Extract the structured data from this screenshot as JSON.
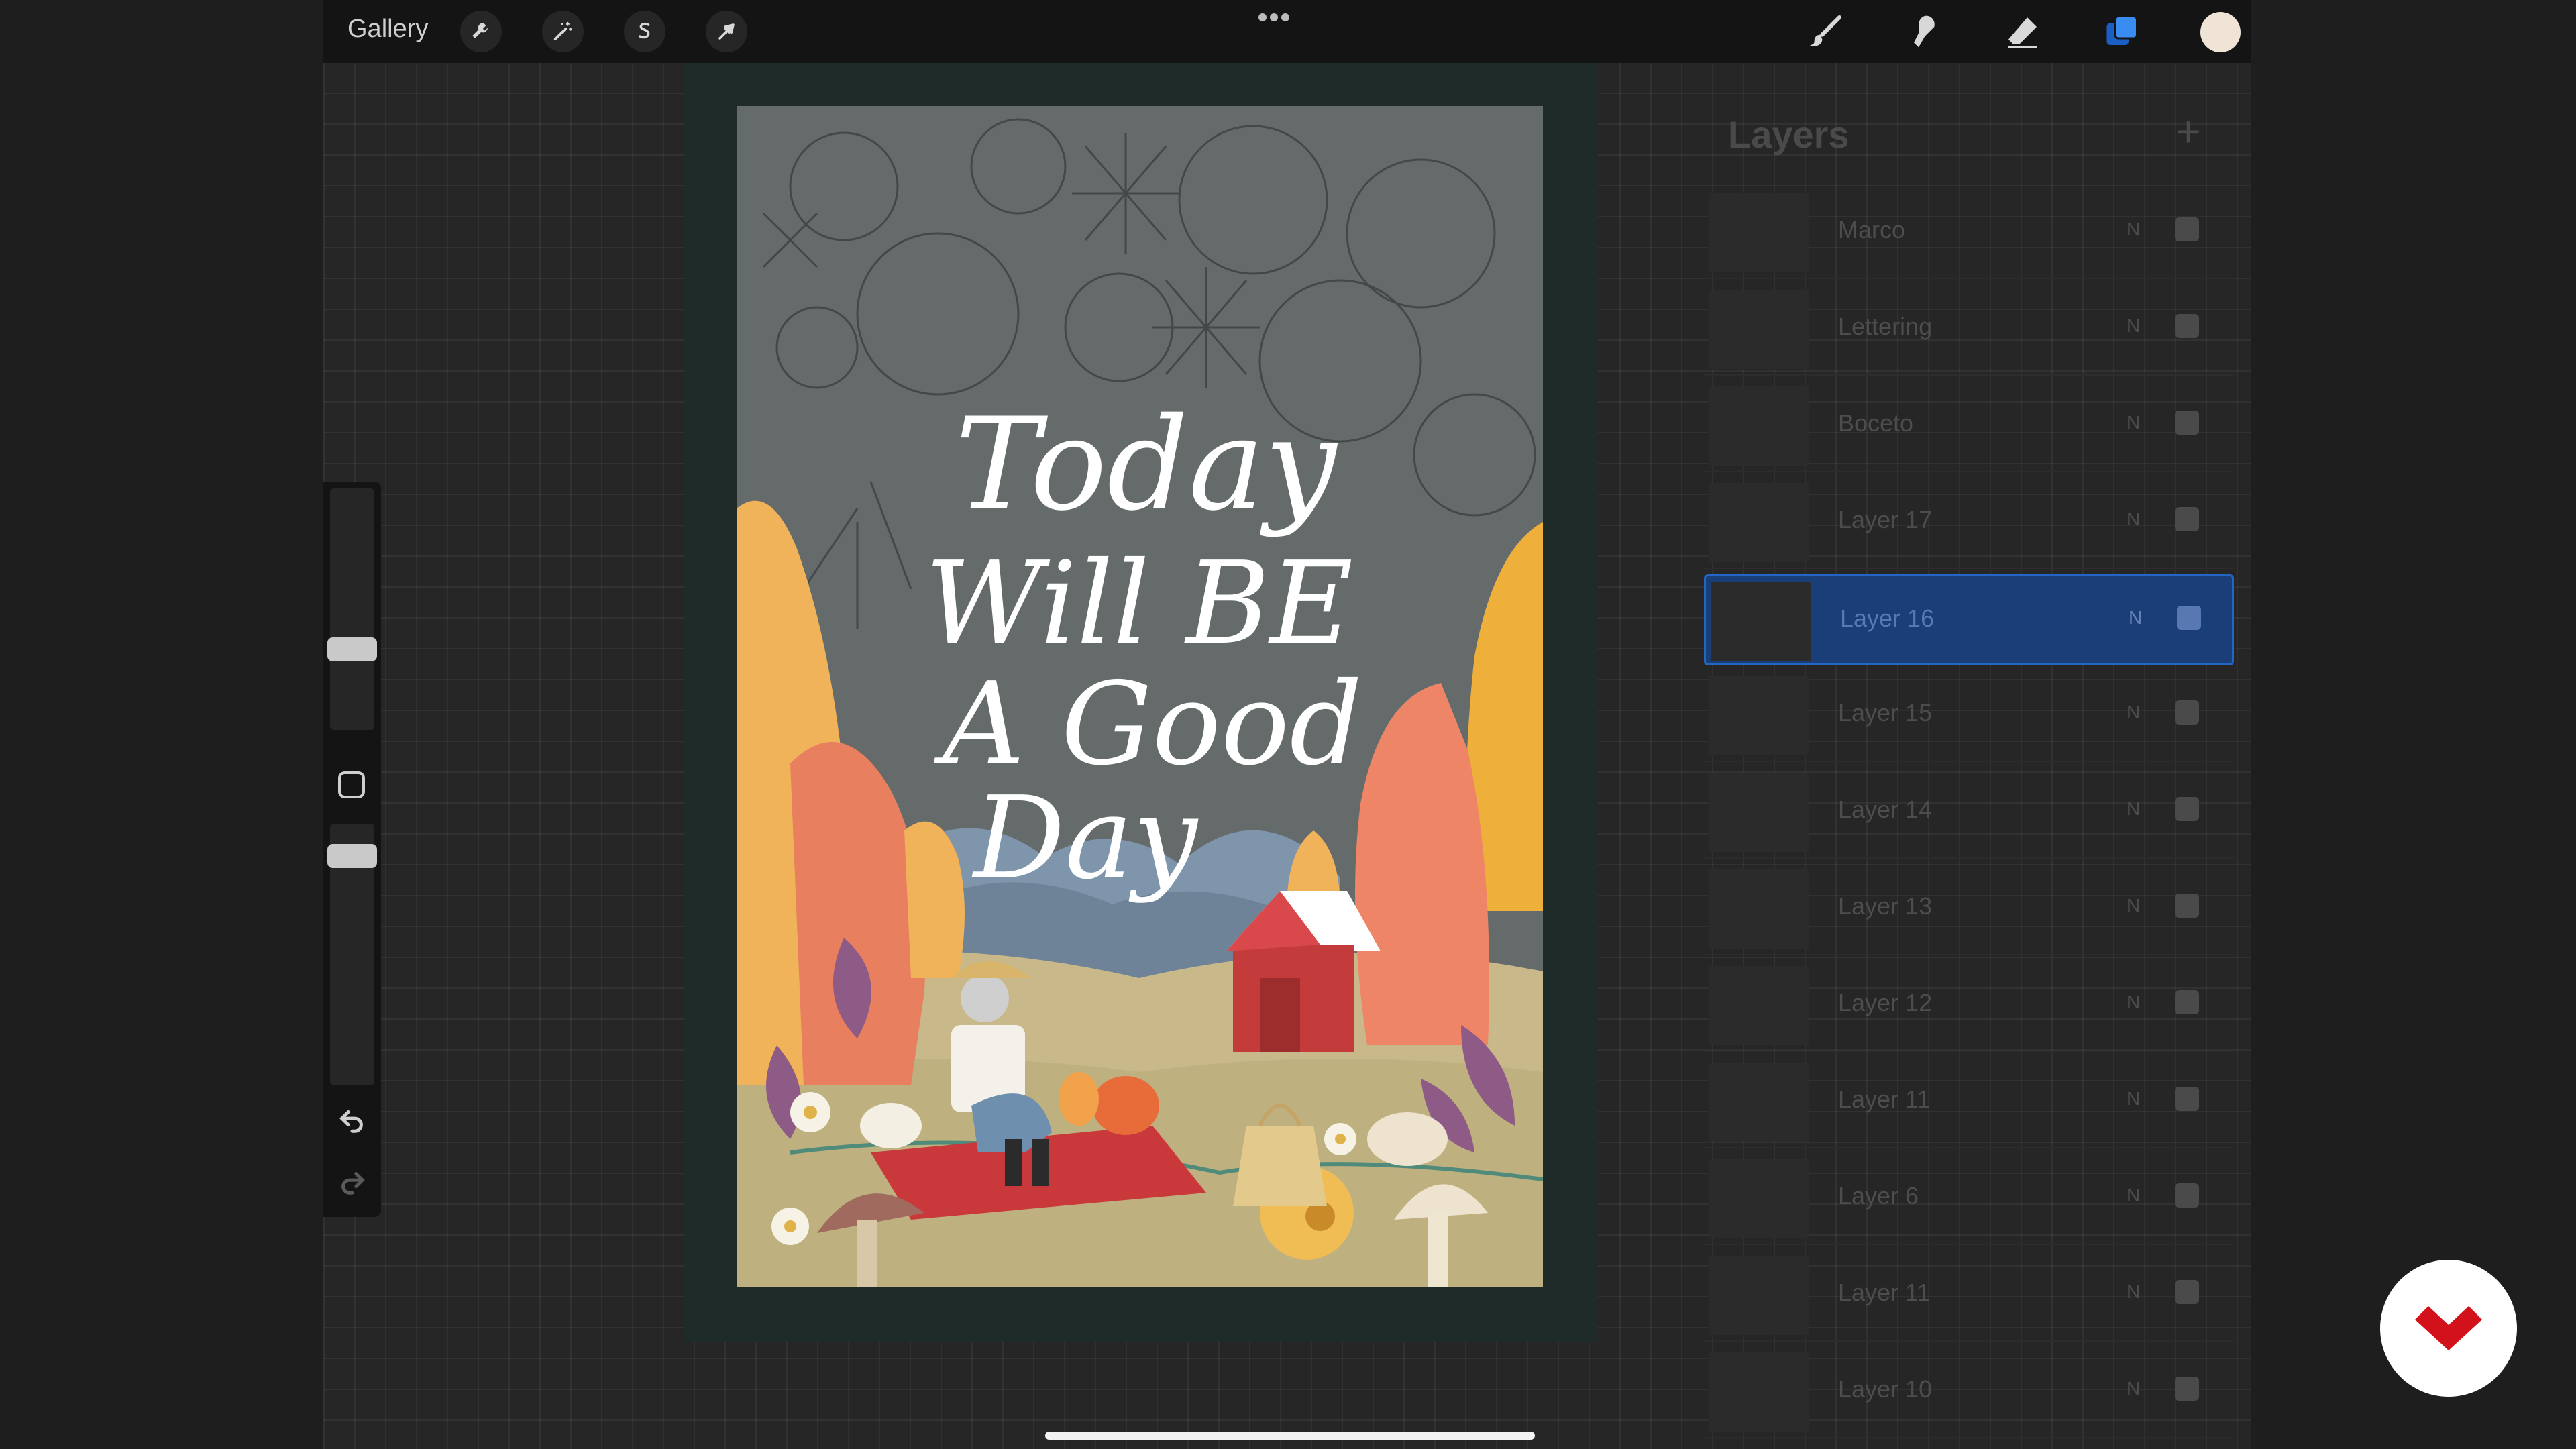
{
  "topbar": {
    "gallery_label": "Gallery",
    "left_tools": [
      "wrench-icon",
      "magic-wand-icon",
      "selection-s-icon",
      "transform-arrow-icon"
    ],
    "right_tools": [
      "brush-icon",
      "smudge-icon",
      "eraser-icon",
      "layers-icon"
    ],
    "current_color": "#f0e4d6"
  },
  "artwork": {
    "lettering": [
      "Today",
      "Will BE",
      "A Good",
      "Day"
    ]
  },
  "layers": {
    "title": "Layers",
    "add_label": "+",
    "items": [
      {
        "name": "Marco",
        "mode": "N",
        "selected": false
      },
      {
        "name": "Lettering",
        "mode": "N",
        "selected": false
      },
      {
        "name": "Boceto",
        "mode": "N",
        "selected": false
      },
      {
        "name": "Layer 17",
        "mode": "N",
        "selected": false
      },
      {
        "name": "Layer 16",
        "mode": "N",
        "selected": true
      },
      {
        "name": "Layer 15",
        "mode": "N",
        "selected": false
      },
      {
        "name": "Layer 14",
        "mode": "N",
        "selected": false
      },
      {
        "name": "Layer 13",
        "mode": "N",
        "selected": false
      },
      {
        "name": "Layer 12",
        "mode": "N",
        "selected": false
      },
      {
        "name": "Layer 11",
        "mode": "N",
        "selected": false
      },
      {
        "name": "Layer 6",
        "mode": "N",
        "selected": false
      },
      {
        "name": "Layer 11",
        "mode": "N",
        "selected": false
      },
      {
        "name": "Layer 10",
        "mode": "N",
        "selected": false
      }
    ]
  },
  "colors": {
    "selected_layer": "#1a3e78",
    "accent_blue": "#2466c4",
    "brand_red": "#d3111b"
  }
}
